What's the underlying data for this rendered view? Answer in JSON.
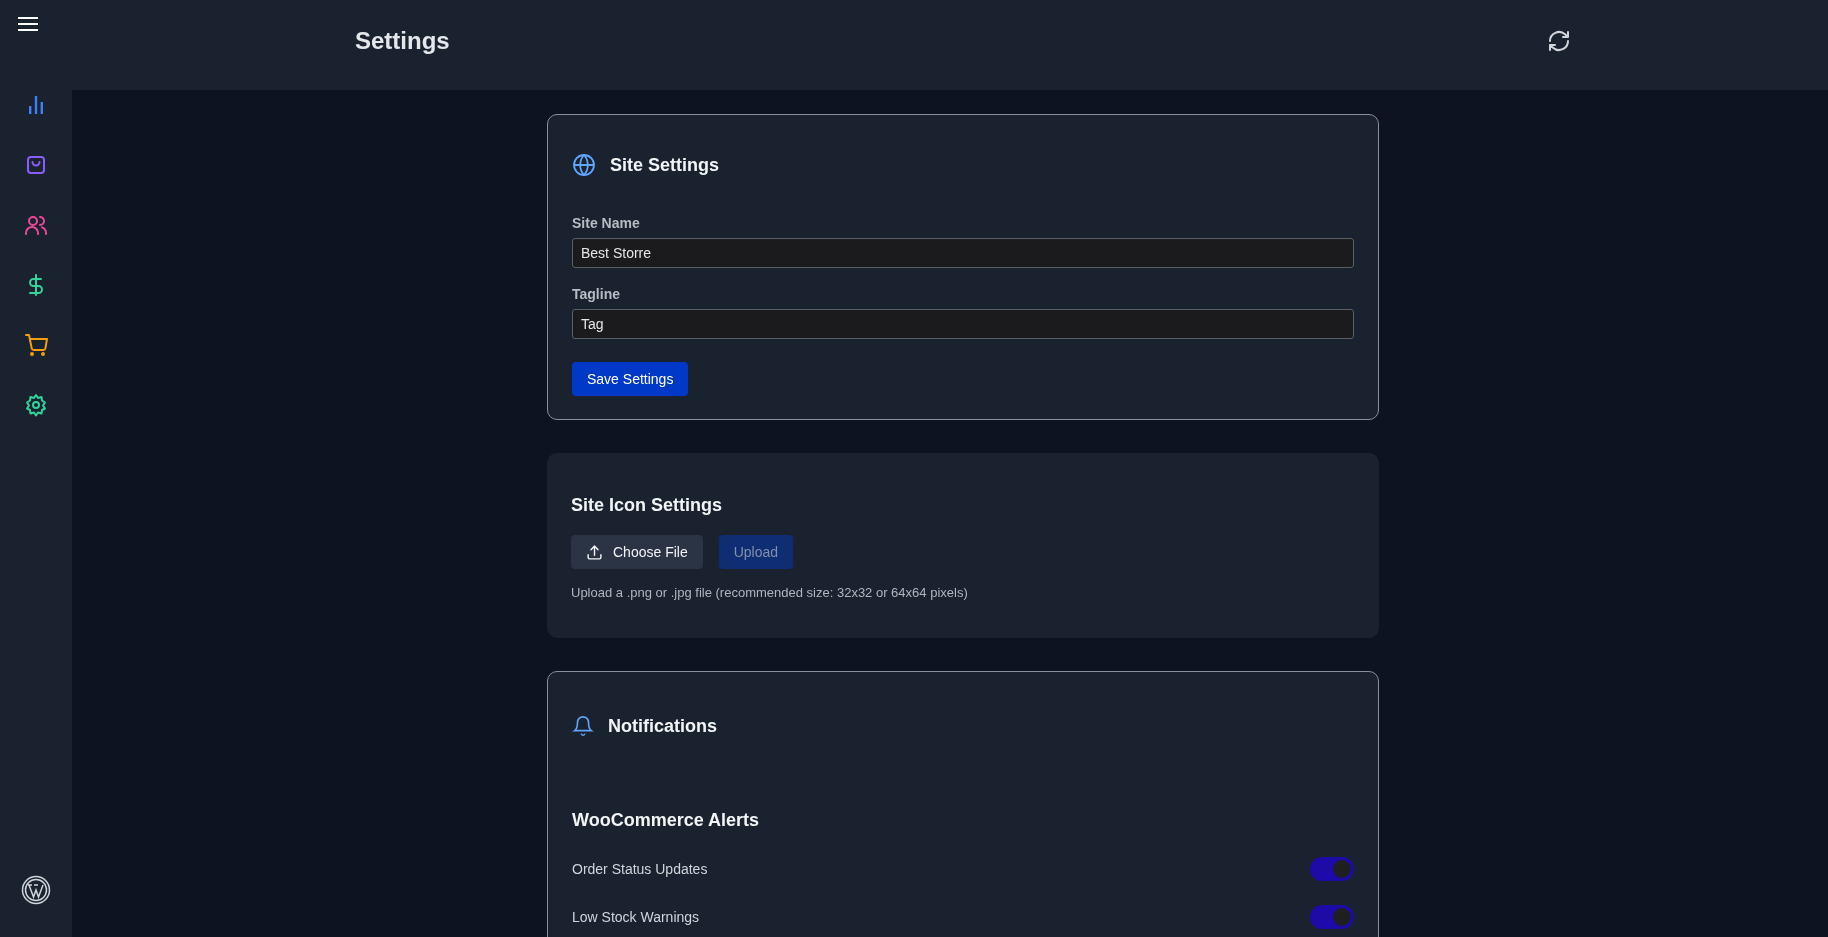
{
  "topbar": {
    "title": "Settings"
  },
  "sidebar": {
    "items": [
      {
        "kind": "chart",
        "color": "#3b82f6"
      },
      {
        "kind": "bag",
        "color": "#8b5cf6"
      },
      {
        "kind": "users",
        "color": "#ec4899"
      },
      {
        "kind": "dollar",
        "color": "#34d399"
      },
      {
        "kind": "cart",
        "color": "#f59e0b"
      },
      {
        "kind": "gear",
        "color": "#34d399"
      }
    ]
  },
  "site_settings": {
    "title": "Site Settings",
    "fields": [
      {
        "label": "Site Name",
        "value": "Best Storre"
      },
      {
        "label": "Tagline",
        "value": "Tag"
      }
    ],
    "save_button": "Save Settings"
  },
  "site_icon_settings": {
    "title": "Site Icon Settings",
    "choose_button": "Choose File",
    "upload_button": {
      "label": "Upload",
      "disabled": true
    },
    "help": "Upload a .png or .jpg file (recommended size: 32x32 or 64x64 pixels)"
  },
  "notifications": {
    "title": "Notifications",
    "sections": [
      {
        "title": "WooCommerce Alerts",
        "items": [
          {
            "label": "Order Status Updates",
            "on": true
          },
          {
            "label": "Low Stock Warnings",
            "on": true
          }
        ]
      }
    ]
  }
}
